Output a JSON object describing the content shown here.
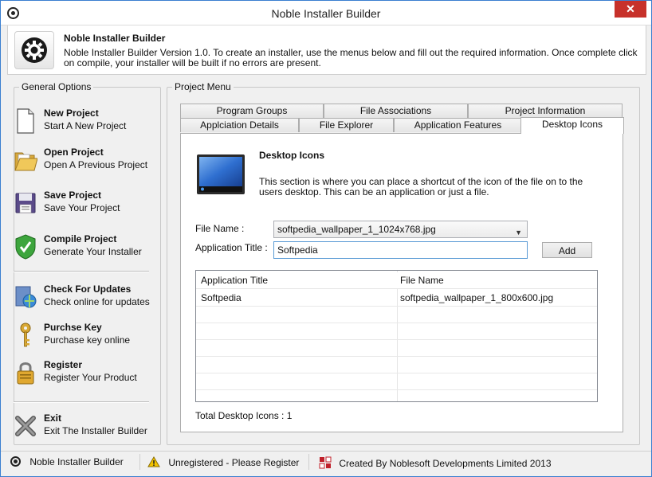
{
  "window": {
    "title": "Noble Installer Builder",
    "close_label": "✕"
  },
  "header": {
    "title": "Noble Installer Builder",
    "description": "Noble Installer Builder Version 1.0. To create an installer, use the menus below and fill out the required information. Once complete click on compile, your installer will be built if no errors are present."
  },
  "general_options": {
    "legend": "General Options",
    "items": [
      {
        "icon": "new-document-icon",
        "title": "New Project",
        "subtitle": "Start A New Project"
      },
      {
        "icon": "folder-open-icon",
        "title": "Open Project",
        "subtitle": "Open A Previous Project"
      },
      {
        "icon": "floppy-disk-icon",
        "title": "Save Project",
        "subtitle": "Save Your Project"
      },
      {
        "icon": "shield-check-icon",
        "title": "Compile Project",
        "subtitle": "Generate Your Installer"
      },
      {
        "icon": "update-globe-icon",
        "title": "Check For Updates",
        "subtitle": "Check online for updates"
      },
      {
        "icon": "key-icon",
        "title": "Purchse Key",
        "subtitle": "Purchase key online"
      },
      {
        "icon": "padlock-icon",
        "title": "Register",
        "subtitle": "Register Your Product"
      },
      {
        "icon": "close-x-icon",
        "title": "Exit",
        "subtitle": "Exit The Installer Builder"
      }
    ]
  },
  "project_menu": {
    "legend": "Project Menu",
    "tabs_row1": [
      "Program Groups",
      "File Associations",
      "Project Information"
    ],
    "tabs_row2": [
      "Applciation Details",
      "File Explorer",
      "Application Features",
      "Desktop Icons"
    ],
    "active_tab": "Desktop Icons"
  },
  "desktop_icons": {
    "title": "Desktop Icons",
    "description": "This section is where you can place a shortcut of the icon of the file on to the users desktop. This can be an application or just a file.",
    "file_name_label": "File Name :",
    "file_name_value": "softpedia_wallpaper_1_1024x768.jpg",
    "app_title_label": "Application Title :",
    "app_title_value": "Softpedia",
    "add_label": "Add",
    "table": {
      "columns": [
        "Application Title",
        "File Name"
      ],
      "rows": [
        [
          "Softpedia",
          "softpedia_wallpaper_1_800x600.jpg"
        ]
      ]
    },
    "total_label": "Total Desktop Icons : 1"
  },
  "statusbar": {
    "app": "Noble Installer Builder",
    "registration": "Unregistered - Please Register",
    "credit": "Created By Noblesoft Developments Limited 2013"
  },
  "colors": {
    "accent": "#3a7fd0",
    "close": "#c7312a",
    "warning": "#f2c300"
  }
}
